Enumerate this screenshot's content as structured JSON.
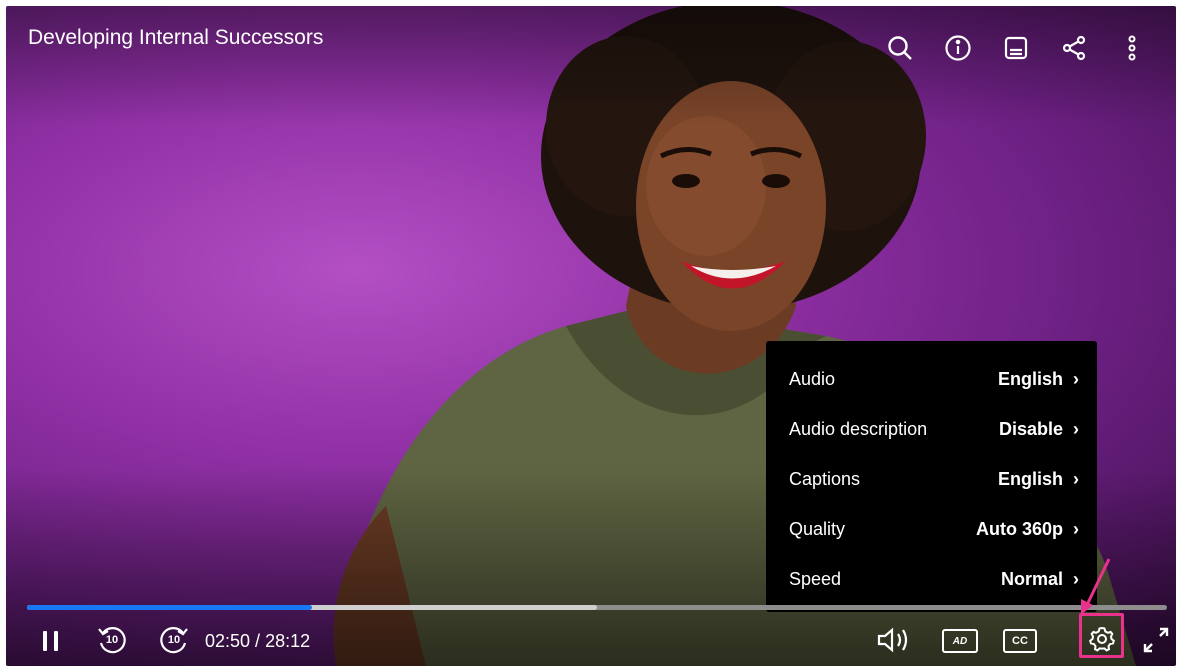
{
  "player": {
    "title": "Developing Internal Successors",
    "top_icons": [
      "search-icon",
      "info-icon",
      "transcript-icon",
      "share-icon",
      "more-icon"
    ],
    "time": {
      "current": "02:50",
      "separator": " / ",
      "total": "28:12"
    },
    "progress": {
      "played_fraction": 0.25,
      "buffered_fraction": 0.5
    },
    "settings_menu": [
      {
        "label": "Audio",
        "value": "English"
      },
      {
        "label": "Audio description",
        "value": "Disable"
      },
      {
        "label": "Captions",
        "value": "English"
      },
      {
        "label": "Quality",
        "value": "Auto 360p"
      },
      {
        "label": "Speed",
        "value": "Normal"
      }
    ],
    "controls": {
      "rewind_label": "10",
      "forward_label": "10",
      "cc_label": "CC",
      "ad_label": "AD"
    }
  },
  "colors": {
    "accent": "#1877f2",
    "highlight": "#e8328b",
    "menu_bg": "#000000"
  }
}
